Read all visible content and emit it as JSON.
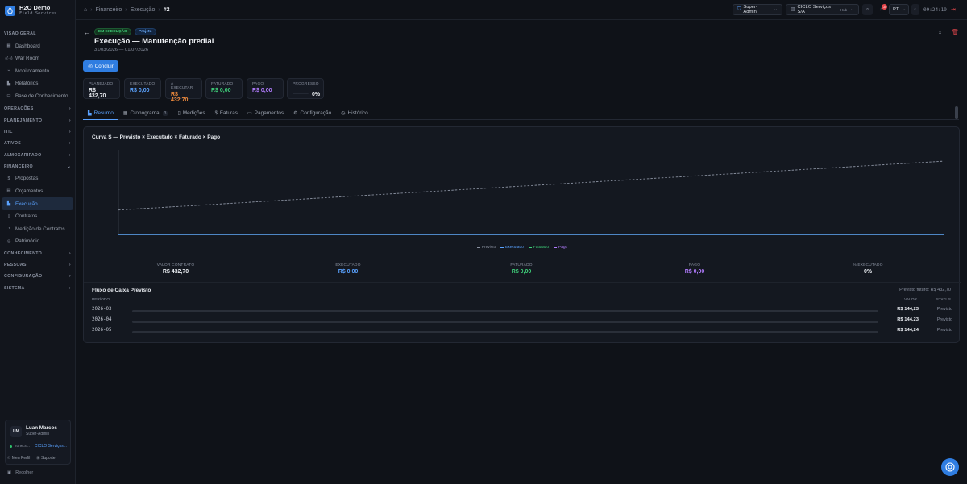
{
  "brand": {
    "title": "H2O Demo",
    "subtitle": "Field Services"
  },
  "sidebar": {
    "visao_geral": "VISÃO GERAL",
    "items_top": [
      {
        "label": "Dashboard",
        "icon": "grid-icon"
      },
      {
        "label": "War Room",
        "icon": "radar-icon"
      },
      {
        "label": "Monitoramento",
        "icon": "activity-icon"
      },
      {
        "label": "Relatórios",
        "icon": "chart-icon"
      },
      {
        "label": "Base de Conhecimento",
        "icon": "book-icon"
      }
    ],
    "sections": [
      "OPERAÇÕES",
      "PLANEJAMENTO",
      "ITIL",
      "ATIVOS",
      "ALMOXARIFADO",
      "FINANCEIRO"
    ],
    "financeiro_items": [
      {
        "label": "Propostas",
        "icon": "dollar-icon"
      },
      {
        "label": "Orçamentos",
        "icon": "calculator-icon"
      },
      {
        "label": "Execução",
        "icon": "chart-icon"
      },
      {
        "label": "Contratos",
        "icon": "file-icon"
      },
      {
        "label": "Medição de Contratos",
        "icon": "gauge-icon"
      },
      {
        "label": "Patrimônio",
        "icon": "building-icon"
      }
    ],
    "sections_bottom": [
      "CONHECIMENTO",
      "PESSOAS",
      "CONFIGURAÇÃO",
      "SISTEMA"
    ],
    "user": {
      "initials": "LM",
      "name": "Luan Marcos",
      "role": "Super-Admin",
      "tenant": "zone.s...",
      "org": "CICLO Serviços...",
      "profile": "Meu Perfil",
      "support": "Suporte"
    },
    "collapse": "Recolher"
  },
  "topbar": {
    "crumbs": [
      "Financeiro",
      "Execução",
      "#2"
    ],
    "role": "Super-Admin",
    "company": "CICLO Serviços S/A",
    "company_tag": "Hub",
    "notif_count": "3",
    "lang": "PT",
    "clock": "09:24:19"
  },
  "header": {
    "status": "EM EXECUÇÃO",
    "type": "Projeto",
    "title": "Execução — Manutenção predial",
    "dates": "31/03/2026 — 01/07/2026",
    "conclude": "Concluir"
  },
  "kpis": [
    {
      "label": "PLANEJADO",
      "value": "R$ 432,70",
      "color": "#e8ebf0"
    },
    {
      "label": "EXECUTADO",
      "value": "R$ 0,00",
      "color": "#5aa2ff"
    },
    {
      "label": "A EXECUTAR",
      "value": "R$ 432,70",
      "color": "#f08a3c"
    },
    {
      "label": "FATURADO",
      "value": "R$ 0,00",
      "color": "#3fd07a"
    },
    {
      "label": "PAGO",
      "value": "R$ 0,00",
      "color": "#b27cff"
    },
    {
      "label": "PROGRESSO",
      "value": "0%",
      "color": "#e8ebf0",
      "progress": 0
    }
  ],
  "tabs": [
    {
      "label": "Resumo",
      "icon": "chart-icon"
    },
    {
      "label": "Cronograma",
      "icon": "calendar-icon",
      "count": "3"
    },
    {
      "label": "Medições",
      "icon": "file-icon"
    },
    {
      "label": "Faturas",
      "icon": "dollar-icon"
    },
    {
      "label": "Pagamentos",
      "icon": "card-icon"
    },
    {
      "label": "Configuração",
      "icon": "gear-icon"
    },
    {
      "label": "Histórico",
      "icon": "history-icon"
    }
  ],
  "chart_data": {
    "type": "line",
    "title": "Curva S — Previsto × Executado × Faturado × Pago",
    "series": [
      {
        "name": "Previsto",
        "color": "#8a91a0",
        "dashed": true,
        "values": [
          144.23,
          432.7
        ]
      },
      {
        "name": "Executado",
        "color": "#5aa2ff",
        "values": [
          0,
          0
        ]
      },
      {
        "name": "Faturado",
        "color": "#3fd07a",
        "values": [
          0,
          0
        ]
      },
      {
        "name": "Pago",
        "color": "#b27cff",
        "values": [
          0,
          0
        ]
      }
    ],
    "grid": false,
    "legend": "bottom-center"
  },
  "summary": [
    {
      "label": "VALOR CONTRATO",
      "value": "R$ 432,70",
      "color": "#e8ebf0"
    },
    {
      "label": "EXECUTADO",
      "value": "R$ 0,00",
      "color": "#5aa2ff"
    },
    {
      "label": "FATURADO",
      "value": "R$ 0,00",
      "color": "#3fd07a"
    },
    {
      "label": "PAGO",
      "value": "R$ 0,00",
      "color": "#b27cff"
    },
    {
      "label": "% EXECUTADO",
      "value": "0%",
      "color": "#e8ebf0"
    }
  ],
  "cashflow": {
    "title": "Fluxo de Caixa Previsto",
    "future": "Previsto futuro: R$ 432,70",
    "col_period": "PERÍODO",
    "col_value": "VALOR",
    "col_status": "STATUS",
    "rows": [
      {
        "period": "2026-03",
        "value": "R$ 144,23",
        "status": "Previsto"
      },
      {
        "period": "2026-04",
        "value": "R$ 144,23",
        "status": "Previsto"
      },
      {
        "period": "2026-05",
        "value": "R$ 144,24",
        "status": "Previsto"
      }
    ]
  }
}
